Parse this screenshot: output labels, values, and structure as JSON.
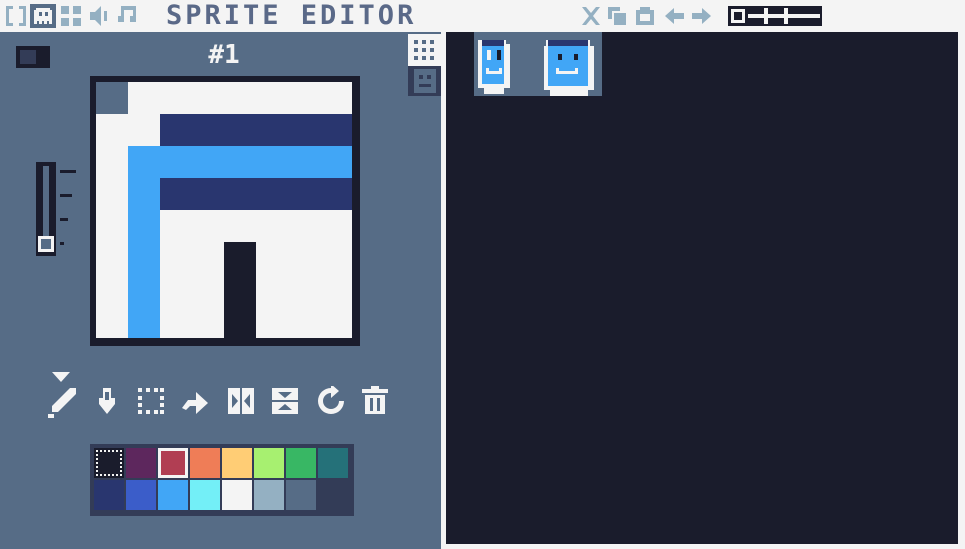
{
  "app": {
    "title": "SPRITE EDITOR"
  },
  "top_bar": {
    "mode_tabs": [
      {
        "icon": "code-icon"
      },
      {
        "icon": "sprite-icon",
        "active": true
      },
      {
        "icon": "map-icon"
      },
      {
        "icon": "sfx-icon"
      },
      {
        "icon": "music-icon"
      }
    ],
    "actions": [
      {
        "icon": "cut-icon"
      },
      {
        "icon": "copy-icon"
      },
      {
        "icon": "paste-icon"
      },
      {
        "icon": "undo-icon"
      },
      {
        "icon": "redo-icon"
      }
    ],
    "bank_toggle": {
      "selected": 0
    }
  },
  "editor": {
    "sprite_index": "#1",
    "size_toggle": {
      "state": "off"
    },
    "brush_size_slider": {
      "level": 0.0
    },
    "view_toggles": [
      {
        "icon": "grid-icon",
        "active": true
      },
      {
        "icon": "face-icon",
        "active": false
      }
    ]
  },
  "tools": [
    {
      "icon": "pencil-icon",
      "active": true
    },
    {
      "icon": "fill-bucket-icon"
    },
    {
      "icon": "select-icon"
    },
    {
      "icon": "move-icon"
    },
    {
      "icon": "flip-horizontal-icon"
    },
    {
      "icon": "flip-vertical-icon"
    },
    {
      "icon": "rotate-icon"
    },
    {
      "icon": "delete-icon"
    }
  ],
  "palette": {
    "selected_index": 2,
    "colors": [
      "#1a1c2c",
      "#5d275d",
      "#b13e53",
      "#ef7d57",
      "#ffcd75",
      "#a7f070",
      "#38b764",
      "#257179",
      "#29366f",
      "#3b5dc9",
      "#41a6f6",
      "#73eff7",
      "#f4f4f4",
      "#94b0c2",
      "#566c86",
      "#333c57"
    ]
  },
  "colors": {
    "panel": "#566c86",
    "background": "#1a1c2c",
    "light": "#f4f4f4",
    "title": "#5a6988",
    "accent_blue": "#41a6f6",
    "navy": "#29366f"
  }
}
